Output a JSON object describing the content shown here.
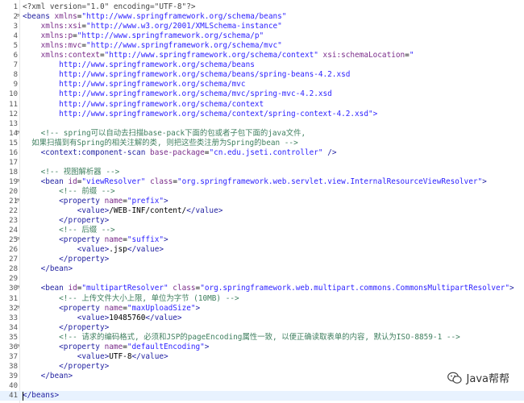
{
  "editor": {
    "lines": [
      {
        "n": "1",
        "fold": "",
        "tokens": [
          [
            "tk-decl",
            "<?xml version=\"1.0\" encoding=\"UTF-8\"?>"
          ]
        ]
      },
      {
        "n": "2",
        "fold": "⊖",
        "tokens": [
          [
            "tk-tag",
            "<beans "
          ],
          [
            "tk-attr",
            "xmlns"
          ],
          [
            "tk-txt",
            "="
          ],
          [
            "tk-val",
            "\"http://www.springframework.org/schema/beans\""
          ]
        ]
      },
      {
        "n": "3",
        "fold": "",
        "tokens": [
          [
            "tk-txt",
            "    "
          ],
          [
            "tk-attr",
            "xmlns:xsi"
          ],
          [
            "tk-txt",
            "="
          ],
          [
            "tk-val",
            "\"http://www.w3.org/2001/XMLSchema-instance\""
          ]
        ]
      },
      {
        "n": "4",
        "fold": "",
        "tokens": [
          [
            "tk-txt",
            "    "
          ],
          [
            "tk-attr",
            "xmlns:p"
          ],
          [
            "tk-txt",
            "="
          ],
          [
            "tk-val",
            "\"http://www.springframework.org/schema/p\""
          ]
        ]
      },
      {
        "n": "5",
        "fold": "",
        "tokens": [
          [
            "tk-txt",
            "    "
          ],
          [
            "tk-attr",
            "xmlns:mvc"
          ],
          [
            "tk-txt",
            "="
          ],
          [
            "tk-val",
            "\"http://www.springframework.org/schema/mvc\""
          ]
        ]
      },
      {
        "n": "6",
        "fold": "",
        "tokens": [
          [
            "tk-txt",
            "    "
          ],
          [
            "tk-attr",
            "xmlns:context"
          ],
          [
            "tk-txt",
            "="
          ],
          [
            "tk-val",
            "\"http://www.springframework.org/schema/context\" "
          ],
          [
            "tk-attr",
            "xsi:schemaLocation"
          ],
          [
            "tk-txt",
            "="
          ],
          [
            "tk-val",
            "\""
          ]
        ]
      },
      {
        "n": "7",
        "fold": "",
        "tokens": [
          [
            "tk-val",
            "        http://www.springframework.org/schema/beans"
          ]
        ]
      },
      {
        "n": "8",
        "fold": "",
        "tokens": [
          [
            "tk-val",
            "        http://www.springframework.org/schema/beans/spring-beans-4.2.xsd"
          ]
        ]
      },
      {
        "n": "9",
        "fold": "",
        "tokens": [
          [
            "tk-val",
            "        http://www.springframework.org/schema/mvc"
          ]
        ]
      },
      {
        "n": "10",
        "fold": "",
        "tokens": [
          [
            "tk-val",
            "        http://www.springframework.org/schema/mvc/spring-mvc-4.2.xsd"
          ]
        ]
      },
      {
        "n": "11",
        "fold": "",
        "tokens": [
          [
            "tk-val",
            "        http://www.springframework.org/schema/context"
          ]
        ]
      },
      {
        "n": "12",
        "fold": "",
        "tokens": [
          [
            "tk-val",
            "        http://www.springframework.org/schema/context/spring-context-4.2.xsd\">"
          ]
        ]
      },
      {
        "n": "13",
        "fold": "",
        "tokens": []
      },
      {
        "n": "14",
        "fold": "⊖",
        "tokens": [
          [
            "tk-cmt",
            "    <!-- spring可以自动去扫描base-pack下面的包或者子包下面的java文件,"
          ]
        ]
      },
      {
        "n": "15",
        "fold": "",
        "tokens": [
          [
            "tk-cmt",
            "  如果扫描到有Spring的相关注解的类, 则把这些类注册为Spring的bean -->"
          ]
        ]
      },
      {
        "n": "16",
        "fold": "",
        "tokens": [
          [
            "tk-txt",
            "    "
          ],
          [
            "tk-tag",
            "<context:component-scan "
          ],
          [
            "tk-attr",
            "base-package"
          ],
          [
            "tk-txt",
            "="
          ],
          [
            "tk-val",
            "\"cn.edu.jseti.controller\""
          ],
          [
            "tk-tag",
            " />"
          ]
        ]
      },
      {
        "n": "17",
        "fold": "",
        "tokens": []
      },
      {
        "n": "18",
        "fold": "",
        "tokens": [
          [
            "tk-cmt",
            "    <!-- 视图解析器 -->"
          ]
        ]
      },
      {
        "n": "19",
        "fold": "⊖",
        "tokens": [
          [
            "tk-txt",
            "    "
          ],
          [
            "tk-tag",
            "<bean "
          ],
          [
            "tk-attr",
            "id"
          ],
          [
            "tk-txt",
            "="
          ],
          [
            "tk-val",
            "\"viewResolver\" "
          ],
          [
            "tk-attr",
            "class"
          ],
          [
            "tk-txt",
            "="
          ],
          [
            "tk-val",
            "\"org.springframework.web.servlet.view.InternalResourceViewResolver\""
          ],
          [
            "tk-tag",
            ">"
          ]
        ]
      },
      {
        "n": "20",
        "fold": "",
        "tokens": [
          [
            "tk-cmt",
            "        <!-- 前缀 -->"
          ]
        ]
      },
      {
        "n": "21",
        "fold": "⊖",
        "tokens": [
          [
            "tk-txt",
            "        "
          ],
          [
            "tk-tag",
            "<property "
          ],
          [
            "tk-attr",
            "name"
          ],
          [
            "tk-txt",
            "="
          ],
          [
            "tk-val",
            "\"prefix\""
          ],
          [
            "tk-tag",
            ">"
          ]
        ]
      },
      {
        "n": "22",
        "fold": "",
        "tokens": [
          [
            "tk-txt",
            "            "
          ],
          [
            "tk-tag",
            "<value>"
          ],
          [
            "tk-txt",
            "/WEB-INF/content/"
          ],
          [
            "tk-tag",
            "</value>"
          ]
        ]
      },
      {
        "n": "23",
        "fold": "",
        "tokens": [
          [
            "tk-txt",
            "        "
          ],
          [
            "tk-tag",
            "</property>"
          ]
        ]
      },
      {
        "n": "24",
        "fold": "",
        "tokens": [
          [
            "tk-cmt",
            "        <!-- 后缀 -->"
          ]
        ]
      },
      {
        "n": "25",
        "fold": "⊖",
        "tokens": [
          [
            "tk-txt",
            "        "
          ],
          [
            "tk-tag",
            "<property "
          ],
          [
            "tk-attr",
            "name"
          ],
          [
            "tk-txt",
            "="
          ],
          [
            "tk-val",
            "\"suffix\""
          ],
          [
            "tk-tag",
            ">"
          ]
        ]
      },
      {
        "n": "26",
        "fold": "",
        "tokens": [
          [
            "tk-txt",
            "            "
          ],
          [
            "tk-tag",
            "<value>"
          ],
          [
            "tk-txt",
            ".jsp"
          ],
          [
            "tk-tag",
            "</value>"
          ]
        ]
      },
      {
        "n": "27",
        "fold": "",
        "tokens": [
          [
            "tk-txt",
            "        "
          ],
          [
            "tk-tag",
            "</property>"
          ]
        ]
      },
      {
        "n": "28",
        "fold": "",
        "tokens": [
          [
            "tk-txt",
            "    "
          ],
          [
            "tk-tag",
            "</bean>"
          ]
        ]
      },
      {
        "n": "29",
        "fold": "",
        "tokens": []
      },
      {
        "n": "30",
        "fold": "⊖",
        "tokens": [
          [
            "tk-txt",
            "    "
          ],
          [
            "tk-tag",
            "<bean "
          ],
          [
            "tk-attr",
            "id"
          ],
          [
            "tk-txt",
            "="
          ],
          [
            "tk-val",
            "\"multipartResolver\" "
          ],
          [
            "tk-attr",
            "class"
          ],
          [
            "tk-txt",
            "="
          ],
          [
            "tk-val",
            "\"org.springframework.web.multipart.commons.CommonsMultipartResolver\""
          ],
          [
            "tk-tag",
            ">"
          ]
        ]
      },
      {
        "n": "31",
        "fold": "",
        "tokens": [
          [
            "tk-cmt",
            "        <!-- 上传文件大小上限, 单位为字节 (10MB) -->"
          ]
        ]
      },
      {
        "n": "32",
        "fold": "⊖",
        "tokens": [
          [
            "tk-txt",
            "        "
          ],
          [
            "tk-tag",
            "<property "
          ],
          [
            "tk-attr",
            "name"
          ],
          [
            "tk-txt",
            "="
          ],
          [
            "tk-val",
            "\"maxUploadSize\""
          ],
          [
            "tk-tag",
            ">"
          ]
        ]
      },
      {
        "n": "33",
        "fold": "",
        "tokens": [
          [
            "tk-txt",
            "            "
          ],
          [
            "tk-tag",
            "<value>"
          ],
          [
            "tk-txt",
            "10485760"
          ],
          [
            "tk-tag",
            "</value>"
          ]
        ]
      },
      {
        "n": "34",
        "fold": "",
        "tokens": [
          [
            "tk-txt",
            "        "
          ],
          [
            "tk-tag",
            "</property>"
          ]
        ]
      },
      {
        "n": "35",
        "fold": "",
        "tokens": [
          [
            "tk-cmt",
            "        <!-- 请求的编码格式, 必须和JSP的pageEncoding属性一致, 以便正确读取表单的内容, 默认为ISO-8859-1 -->"
          ]
        ]
      },
      {
        "n": "36",
        "fold": "⊖",
        "tokens": [
          [
            "tk-txt",
            "        "
          ],
          [
            "tk-tag",
            "<property "
          ],
          [
            "tk-attr",
            "name"
          ],
          [
            "tk-txt",
            "="
          ],
          [
            "tk-val",
            "\"defaultEncoding\""
          ],
          [
            "tk-tag",
            ">"
          ]
        ]
      },
      {
        "n": "37",
        "fold": "",
        "tokens": [
          [
            "tk-txt",
            "            "
          ],
          [
            "tk-tag",
            "<value>"
          ],
          [
            "tk-txt",
            "UTF-8"
          ],
          [
            "tk-tag",
            "</value>"
          ]
        ]
      },
      {
        "n": "38",
        "fold": "",
        "tokens": [
          [
            "tk-txt",
            "        "
          ],
          [
            "tk-tag",
            "</property>"
          ]
        ]
      },
      {
        "n": "39",
        "fold": "",
        "tokens": [
          [
            "tk-txt",
            "    "
          ],
          [
            "tk-tag",
            "</bean>"
          ]
        ]
      },
      {
        "n": "40",
        "fold": "",
        "tokens": []
      },
      {
        "n": "41",
        "fold": "",
        "tokens": [
          [
            "tk-tag",
            "</beans>"
          ]
        ]
      }
    ]
  },
  "watermark": {
    "text": "Java帮帮",
    "icon": "wechat-icon"
  }
}
